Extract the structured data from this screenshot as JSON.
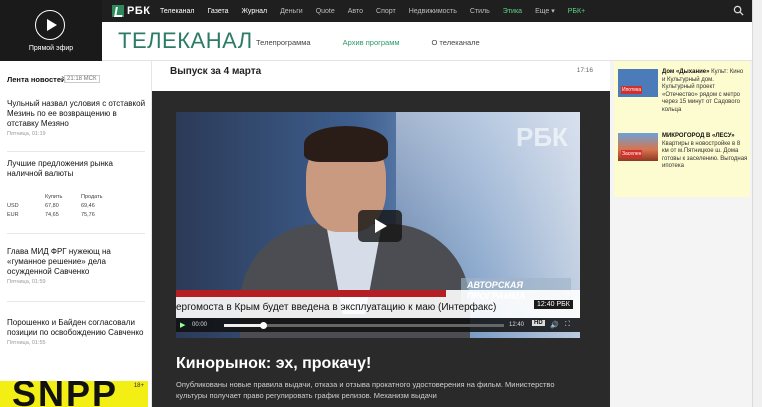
{
  "live": {
    "label": "Прямой эфир",
    "icon": "play-circle-icon"
  },
  "topnav": {
    "logo": "РБК",
    "items": [
      {
        "label": "Телеканал",
        "state": "active"
      },
      {
        "label": "Газета",
        "state": "active"
      },
      {
        "label": "Журнал",
        "state": "active"
      },
      {
        "label": "Деньги",
        "state": ""
      },
      {
        "label": "Quote",
        "state": ""
      },
      {
        "label": "Авто",
        "state": ""
      },
      {
        "label": "Спорт",
        "state": ""
      },
      {
        "label": "Недвижимость",
        "state": ""
      },
      {
        "label": "Стиль",
        "state": ""
      },
      {
        "label": "Этика",
        "state": "green"
      },
      {
        "label": "Еще ▾",
        "state": ""
      },
      {
        "label": "РБК+",
        "state": "green"
      }
    ]
  },
  "subhead": {
    "title": "ТЕЛЕКАНАЛ",
    "tabs": [
      {
        "label": "Телепрограмма",
        "selected": false
      },
      {
        "label": "Архив программ",
        "selected": true
      },
      {
        "label": "О телеканале",
        "selected": false
      }
    ]
  },
  "news": {
    "heading": "Лента новостей",
    "heading_time": "21:18 МСК",
    "items": [
      {
        "title": "Чульный назвал условия с отставкой Мезинь по ее возвращению в отставку Мезяно",
        "date": "Пятница, 01:19"
      },
      {
        "title": "Лучшие предложения рынка наличной валюты",
        "date": ""
      },
      {
        "title": "Глава МИД ФРГ нужеющ на «гуманное решение» дела осужденной Савченко",
        "date": "Пятница, 01:59"
      },
      {
        "title": "Порошенко и Байден согласовали позиции по освобождению Савченко",
        "date": "Пятница, 01:55"
      }
    ],
    "rates": {
      "headers": [
        "",
        "Купить",
        "Продать"
      ],
      "rows": [
        [
          "USD",
          "67,80",
          "69,46"
        ],
        [
          "EUR",
          "74,65",
          "75,76"
        ]
      ]
    },
    "ad": {
      "text": "SNPP",
      "tag": "18+"
    }
  },
  "main": {
    "episode": "Выпуск за 4 марта",
    "episode_time": "17:16",
    "video": {
      "logo": "РБК",
      "tag": "АВТОРСКАЯ ПРОГРАММА",
      "ticker": "ергомоста в Крым будет введена в эксплуатацию к маю (Интерфакс)",
      "current_time": "00:00",
      "duration": "12:40",
      "badge": "12:40 РБК",
      "hd": "HD",
      "progress": 0.14
    },
    "headline": "Кинорынок: эх, прокачу!",
    "description": "Опубликованы новые правила выдачи, отказа и отзыва прокатного удостоверения на фильм. Министерство культуры получает право регулировать график релизов. Механизм выдачи"
  },
  "right": {
    "promos": [
      {
        "title": "Дом «Дыхание»",
        "text": "Культ: Кино и Культурный дом. Культурный проект «Отечество» рядом с метро через 15 минут от Садового кольца",
        "badge": "Ипотека"
      },
      {
        "title": "МИКРОГОРОД В «ЛЕСУ»",
        "text": "Квартиры в новостройке в 8 км от м.Пятницкое ш. Дома готовы к заселению. Выгодная ипотека",
        "badge": "Заселен"
      }
    ]
  }
}
